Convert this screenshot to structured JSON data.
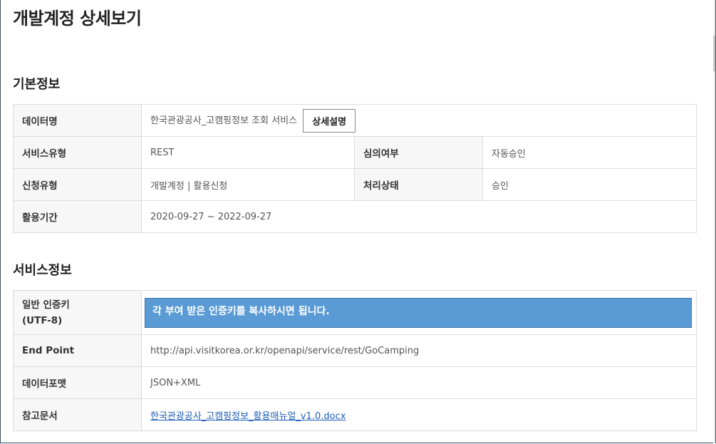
{
  "page": {
    "title": "개발계정 상세보기"
  },
  "basic": {
    "section_title": "기본정보",
    "data_name_label": "데이터명",
    "data_name_value": "한국관광공사_고캠핑정보 조회 서비스",
    "detail_button": "상세설명",
    "service_type_label": "서비스유형",
    "service_type_value": "REST",
    "review_label": "심의여부",
    "review_value": "자동승인",
    "apply_type_label": "신청유형",
    "apply_type_value": "개발계정 | 활용신청",
    "status_label": "처리상태",
    "status_value": "승인",
    "period_label": "활용기간",
    "period_value": "2020-09-27 ~ 2022-09-27"
  },
  "service": {
    "section_title": "서비스정보",
    "key_label_line1": "일반 인증키",
    "key_label_line2": "(UTF-8)",
    "key_value": "각 부여 받은 인증키를 복사하시면 됩니다.",
    "endpoint_label": "End Point",
    "endpoint_value": "http://api.visitkorea.or.kr/openapi/service/rest/GoCamping",
    "format_label": "데이터포맷",
    "format_value": "JSON+XML",
    "doc_label": "참고문서",
    "doc_value": "한국관광공사_고캠핑정보_활용매뉴얼_v1.0.docx"
  }
}
